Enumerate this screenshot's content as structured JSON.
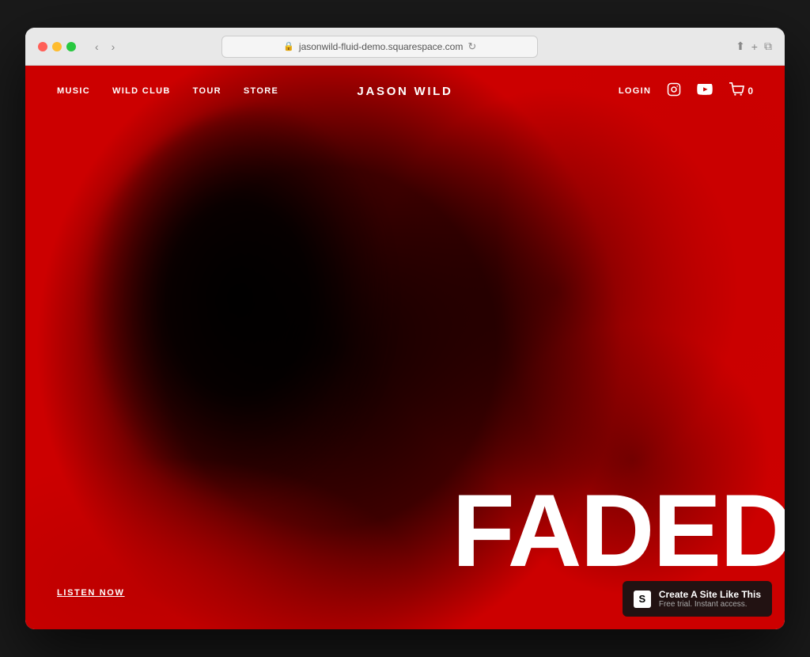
{
  "browser": {
    "url": "jasonwild-fluid-demo.squarespace.com",
    "reload_label": "⟳"
  },
  "navbar": {
    "music": "MUSIC",
    "wild_club": "WILD CLUB",
    "tour": "TOUR",
    "store": "STORE",
    "brand": "JASON WILD",
    "login": "LOGIN",
    "cart_count": "0"
  },
  "hero": {
    "title": "FADED",
    "cta": "LISTEN NOW"
  },
  "badge": {
    "title": "Create A Site Like This",
    "subtitle": "Free trial. Instant access."
  },
  "icons": {
    "lock": "🔒",
    "back": "‹",
    "forward": "›",
    "share": "⬆",
    "new_tab": "+",
    "tabs": "⧉",
    "instagram": "◻",
    "youtube": "▶",
    "cart": "🛒"
  }
}
